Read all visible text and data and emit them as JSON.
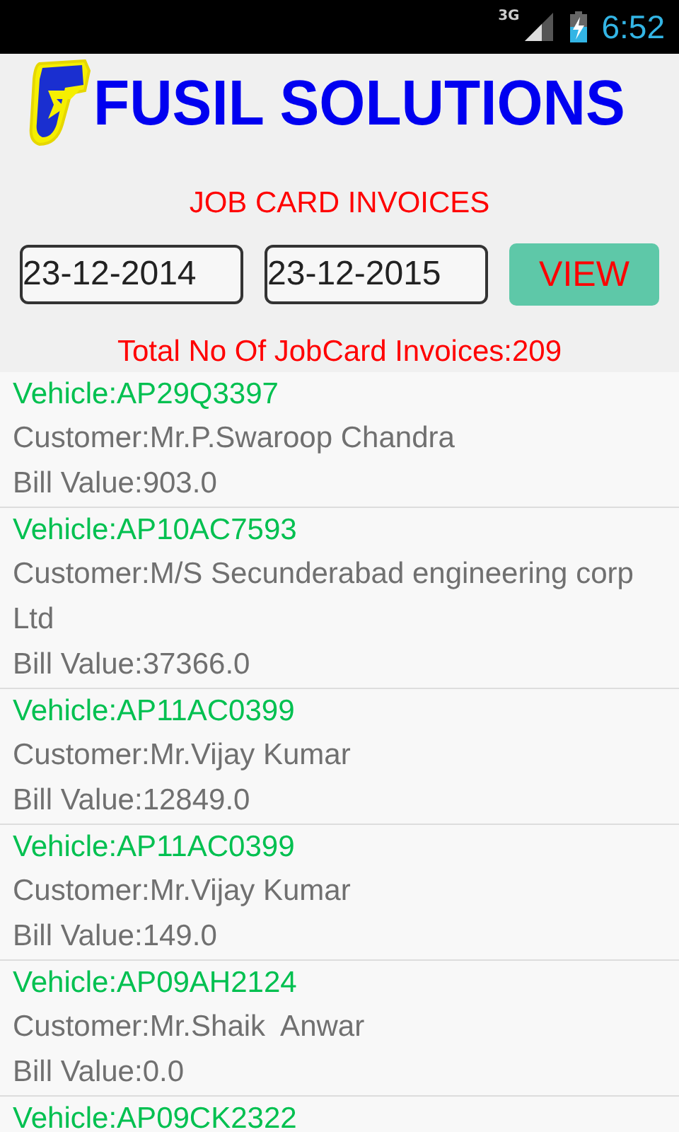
{
  "status_bar": {
    "network": "3G",
    "time": "6:52"
  },
  "header": {
    "title": "FUSIL SOLUTIONS"
  },
  "section_title": "JOB CARD INVOICES",
  "filters": {
    "from_date": "23-12-2014",
    "to_date": "23-12-2015",
    "button": "VIEW"
  },
  "total": "Total No Of JobCard Invoices:209",
  "invoices": [
    {
      "vehicle": "Vehicle:AP29Q3397",
      "customer": "Customer:Mr.P.Swaroop Chandra",
      "bill": "Bill Value:903.0"
    },
    {
      "vehicle": "Vehicle:AP10AC7593",
      "customer": "Customer:M/S Secunderabad engineering corp Ltd",
      "bill": "Bill Value:37366.0"
    },
    {
      "vehicle": "Vehicle:AP11AC0399",
      "customer": "Customer:Mr.Vijay Kumar",
      "bill": "Bill Value:12849.0"
    },
    {
      "vehicle": "Vehicle:AP11AC0399",
      "customer": "Customer:Mr.Vijay Kumar",
      "bill": "Bill Value:149.0"
    },
    {
      "vehicle": "Vehicle:AP09AH2124",
      "customer": "Customer:Mr.Shaik  Anwar",
      "bill": "Bill Value:0.0"
    },
    {
      "vehicle": "Vehicle:AP09CK2322"
    }
  ]
}
